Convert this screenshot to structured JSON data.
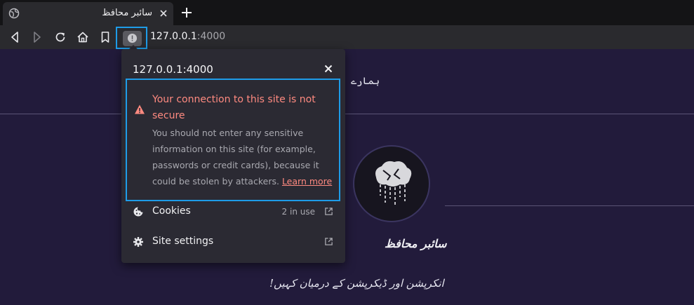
{
  "tab": {
    "title": "سائبر محافظ"
  },
  "address_bar": {
    "host": "127.0.0.1",
    "port": ":4000"
  },
  "page": {
    "header_text": "ہمارے",
    "author_name": "سائبر محافظ",
    "tagline": "انکرپشن اور ڈیکرپشن کے درمیان کہیں!"
  },
  "popup": {
    "host": "127.0.0.1:4000",
    "warning_title": "Your connection to this site is not secure",
    "warning_body": "You should not enter any sensitive information on this site (for example, passwords or credit cards), because it could be stolen by attackers.",
    "learn_more": "Learn more",
    "cookies_label": "Cookies",
    "cookies_value": "2 in use",
    "site_settings_label": "Site settings"
  },
  "colors": {
    "accent": "#1e9ce8",
    "warning": "#ff8a80",
    "page_bg": "#221b3b",
    "popup_bg": "#2b2a33"
  }
}
